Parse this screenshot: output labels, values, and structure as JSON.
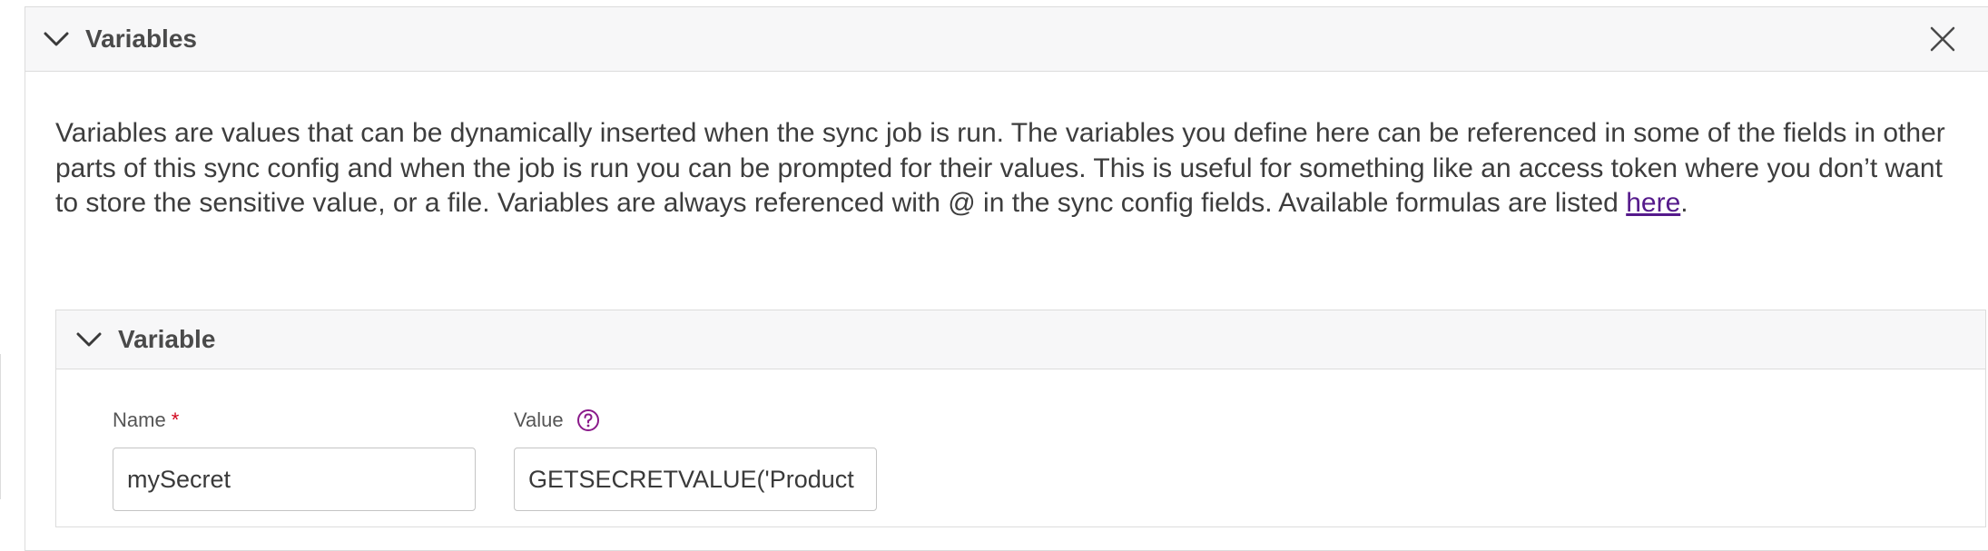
{
  "panel": {
    "title": "Variables",
    "description_text": "Variables are values that can be dynamically inserted when the sync job is run. The variables you define here can be referenced in some of the fields in other parts of this sync config and when the job is run you can be prompted for their values. This is useful for something like an access token where you don’t want to store the sensitive value, or a file. Variables are always referenced with @ in the sync config fields. Available formulas are listed ",
    "description_link": "here",
    "description_end": "."
  },
  "variable": {
    "title": "Variable",
    "name_label": "Name",
    "required_marker": "*",
    "name_value": "mySecret",
    "value_label": "Value",
    "value_value": "GETSECRETVALUE('Product"
  },
  "icons": {
    "collapse": "chevron-down-icon",
    "close": "close-icon",
    "help": "help-circle-icon"
  },
  "colors": {
    "link": "#551a8b",
    "required": "#d0021b",
    "help_icon": "#8a1a8a"
  }
}
